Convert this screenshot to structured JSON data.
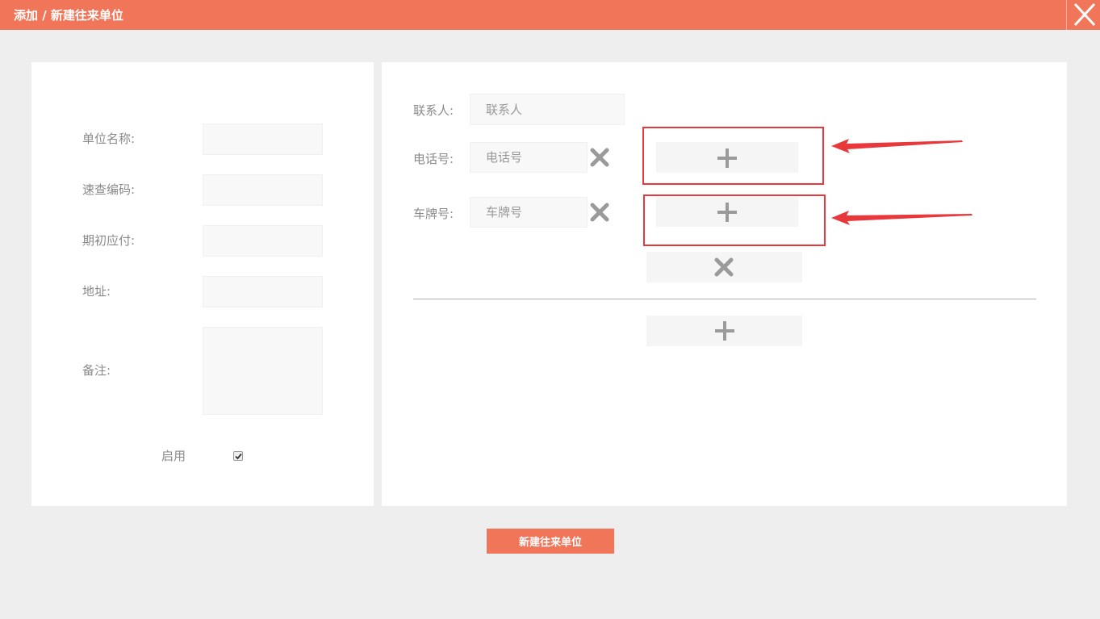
{
  "header": {
    "title": "添加 / 新建往来单位"
  },
  "form": {
    "unit_name_label": "单位名称:",
    "quick_code_label": "速查编码:",
    "opening_payable_label": "期初应付:",
    "address_label": "地址:",
    "remark_label": "备注:",
    "enabled_label": "启用",
    "enabled_checked": true
  },
  "contact": {
    "contact_label": "联系人:",
    "contact_placeholder": "联系人",
    "phone_label": "电话号:",
    "phone_placeholder": "电话号",
    "plate_label": "车牌号:",
    "plate_placeholder": "车牌号"
  },
  "footer": {
    "submit_label": "新建往来单位"
  },
  "colors": {
    "accent": "#f07559",
    "highlight": "#e8383c",
    "panel_bg": "#ffffff",
    "page_bg": "#eeeeee"
  }
}
